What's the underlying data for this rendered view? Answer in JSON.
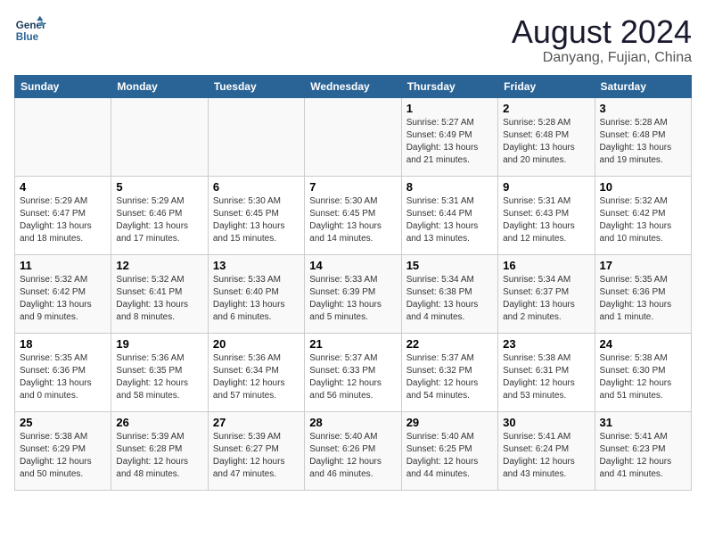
{
  "header": {
    "logo_line1": "General",
    "logo_line2": "Blue",
    "month_year": "August 2024",
    "location": "Danyang, Fujian, China"
  },
  "days_of_week": [
    "Sunday",
    "Monday",
    "Tuesday",
    "Wednesday",
    "Thursday",
    "Friday",
    "Saturday"
  ],
  "weeks": [
    [
      {
        "day": "",
        "info": ""
      },
      {
        "day": "",
        "info": ""
      },
      {
        "day": "",
        "info": ""
      },
      {
        "day": "",
        "info": ""
      },
      {
        "day": "1",
        "info": "Sunrise: 5:27 AM\nSunset: 6:49 PM\nDaylight: 13 hours\nand 21 minutes."
      },
      {
        "day": "2",
        "info": "Sunrise: 5:28 AM\nSunset: 6:48 PM\nDaylight: 13 hours\nand 20 minutes."
      },
      {
        "day": "3",
        "info": "Sunrise: 5:28 AM\nSunset: 6:48 PM\nDaylight: 13 hours\nand 19 minutes."
      }
    ],
    [
      {
        "day": "4",
        "info": "Sunrise: 5:29 AM\nSunset: 6:47 PM\nDaylight: 13 hours\nand 18 minutes."
      },
      {
        "day": "5",
        "info": "Sunrise: 5:29 AM\nSunset: 6:46 PM\nDaylight: 13 hours\nand 17 minutes."
      },
      {
        "day": "6",
        "info": "Sunrise: 5:30 AM\nSunset: 6:45 PM\nDaylight: 13 hours\nand 15 minutes."
      },
      {
        "day": "7",
        "info": "Sunrise: 5:30 AM\nSunset: 6:45 PM\nDaylight: 13 hours\nand 14 minutes."
      },
      {
        "day": "8",
        "info": "Sunrise: 5:31 AM\nSunset: 6:44 PM\nDaylight: 13 hours\nand 13 minutes."
      },
      {
        "day": "9",
        "info": "Sunrise: 5:31 AM\nSunset: 6:43 PM\nDaylight: 13 hours\nand 12 minutes."
      },
      {
        "day": "10",
        "info": "Sunrise: 5:32 AM\nSunset: 6:42 PM\nDaylight: 13 hours\nand 10 minutes."
      }
    ],
    [
      {
        "day": "11",
        "info": "Sunrise: 5:32 AM\nSunset: 6:42 PM\nDaylight: 13 hours\nand 9 minutes."
      },
      {
        "day": "12",
        "info": "Sunrise: 5:32 AM\nSunset: 6:41 PM\nDaylight: 13 hours\nand 8 minutes."
      },
      {
        "day": "13",
        "info": "Sunrise: 5:33 AM\nSunset: 6:40 PM\nDaylight: 13 hours\nand 6 minutes."
      },
      {
        "day": "14",
        "info": "Sunrise: 5:33 AM\nSunset: 6:39 PM\nDaylight: 13 hours\nand 5 minutes."
      },
      {
        "day": "15",
        "info": "Sunrise: 5:34 AM\nSunset: 6:38 PM\nDaylight: 13 hours\nand 4 minutes."
      },
      {
        "day": "16",
        "info": "Sunrise: 5:34 AM\nSunset: 6:37 PM\nDaylight: 13 hours\nand 2 minutes."
      },
      {
        "day": "17",
        "info": "Sunrise: 5:35 AM\nSunset: 6:36 PM\nDaylight: 13 hours\nand 1 minute."
      }
    ],
    [
      {
        "day": "18",
        "info": "Sunrise: 5:35 AM\nSunset: 6:36 PM\nDaylight: 13 hours\nand 0 minutes."
      },
      {
        "day": "19",
        "info": "Sunrise: 5:36 AM\nSunset: 6:35 PM\nDaylight: 12 hours\nand 58 minutes."
      },
      {
        "day": "20",
        "info": "Sunrise: 5:36 AM\nSunset: 6:34 PM\nDaylight: 12 hours\nand 57 minutes."
      },
      {
        "day": "21",
        "info": "Sunrise: 5:37 AM\nSunset: 6:33 PM\nDaylight: 12 hours\nand 56 minutes."
      },
      {
        "day": "22",
        "info": "Sunrise: 5:37 AM\nSunset: 6:32 PM\nDaylight: 12 hours\nand 54 minutes."
      },
      {
        "day": "23",
        "info": "Sunrise: 5:38 AM\nSunset: 6:31 PM\nDaylight: 12 hours\nand 53 minutes."
      },
      {
        "day": "24",
        "info": "Sunrise: 5:38 AM\nSunset: 6:30 PM\nDaylight: 12 hours\nand 51 minutes."
      }
    ],
    [
      {
        "day": "25",
        "info": "Sunrise: 5:38 AM\nSunset: 6:29 PM\nDaylight: 12 hours\nand 50 minutes."
      },
      {
        "day": "26",
        "info": "Sunrise: 5:39 AM\nSunset: 6:28 PM\nDaylight: 12 hours\nand 48 minutes."
      },
      {
        "day": "27",
        "info": "Sunrise: 5:39 AM\nSunset: 6:27 PM\nDaylight: 12 hours\nand 47 minutes."
      },
      {
        "day": "28",
        "info": "Sunrise: 5:40 AM\nSunset: 6:26 PM\nDaylight: 12 hours\nand 46 minutes."
      },
      {
        "day": "29",
        "info": "Sunrise: 5:40 AM\nSunset: 6:25 PM\nDaylight: 12 hours\nand 44 minutes."
      },
      {
        "day": "30",
        "info": "Sunrise: 5:41 AM\nSunset: 6:24 PM\nDaylight: 12 hours\nand 43 minutes."
      },
      {
        "day": "31",
        "info": "Sunrise: 5:41 AM\nSunset: 6:23 PM\nDaylight: 12 hours\nand 41 minutes."
      }
    ]
  ]
}
